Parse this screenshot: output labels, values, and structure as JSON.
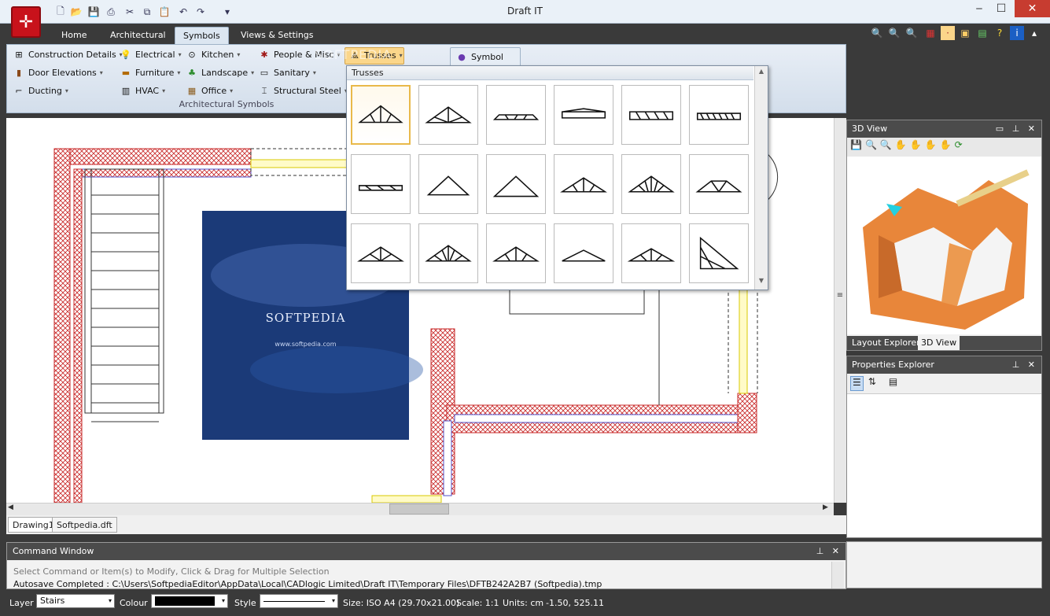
{
  "window": {
    "title": "Draft IT",
    "minimize": "‒",
    "maximize": "☐",
    "close": "✕"
  },
  "ribbon_tabs": [
    "Home",
    "Architectural",
    "Symbols",
    "Views & Settings"
  ],
  "ribbon": {
    "col1": [
      "Construction Details",
      "Door Elevations",
      "Ducting"
    ],
    "col2": [
      "Electrical",
      "Furniture",
      "HVAC"
    ],
    "col3": [
      "Kitchen",
      "Landscape",
      "Office"
    ],
    "col4": [
      "People & Misc",
      "Sanitary",
      "Structural Steel"
    ],
    "trusses": "Trusses",
    "symbol": "Symbol",
    "group_label": "Architectural Symbols",
    "watermark": "SOFTPEDIA"
  },
  "trusses_panel": {
    "header": "Trusses"
  },
  "canvas": {
    "logo_text": "SOFTPEDIA",
    "logo_url": "www.softpedia.com"
  },
  "doc_tabs": [
    "Drawing1",
    "Softpedia.dft"
  ],
  "panes": {
    "view3d_title": "3D View",
    "layout_explorer_tab": "Layout Explorer",
    "view3d_tab": "3D View",
    "properties_title": "Properties Explorer"
  },
  "command": {
    "title": "Command Window",
    "hint": "Select Command or Item(s) to Modify, Click & Drag for Multiple Selection",
    "log": "Autosave Completed : C:\\Users\\SoftpediaEditor\\AppData\\Local\\CADlogic Limited\\Draft IT\\Temporary Files\\DFTB242A2B7 (Softpedia).tmp"
  },
  "status": {
    "layer_label": "Layer",
    "layer_value": "Stairs",
    "colour_label": "Colour",
    "style_label": "Style",
    "size": "Size: ISO A4 (29.70x21.00)",
    "scale": "Scale: 1:1",
    "units": "Units: cm",
    "coords": "-1.50, 525.11"
  }
}
